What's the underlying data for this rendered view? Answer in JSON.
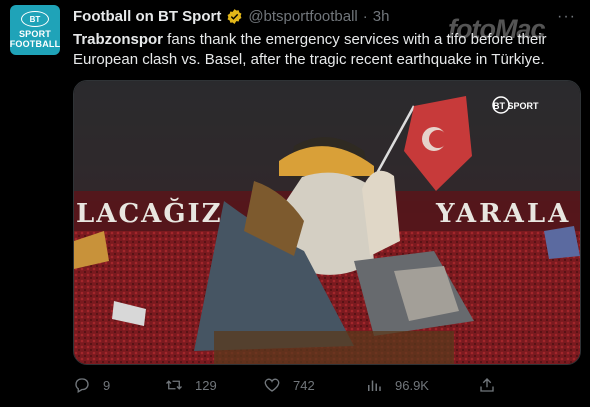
{
  "account": {
    "name": "Football on BT Sport",
    "handle": "@btsportfootball",
    "separator": "·",
    "time": "3h",
    "avatar_lines": [
      "BT",
      "SPORT",
      "FOOTBALL"
    ]
  },
  "tweet": {
    "text_bold": "Trabzonspor",
    "text_rest": " fans thank the emergency services with a tifo before their European clash vs. Basel, after the tragic recent earthquake in Türkiye."
  },
  "media": {
    "banner_left": "LACAĞIZ",
    "banner_right": "YARALA",
    "broadcaster_logo": "BT SPORT"
  },
  "actions": {
    "replies": "9",
    "retweets": "129",
    "likes": "742",
    "views": "96.9K"
  },
  "watermark": "fotoMac",
  "more_label": "···",
  "colors": {
    "background": "#000000",
    "text": "#e7e9ea",
    "muted": "#71767b",
    "brand": "#1fa3b8",
    "verified": "#e2b719",
    "crowd": "#7a1a1f"
  },
  "icons": [
    "verified-badge-icon",
    "more-icon",
    "reply-icon",
    "retweet-icon",
    "like-icon",
    "views-icon",
    "share-icon"
  ]
}
